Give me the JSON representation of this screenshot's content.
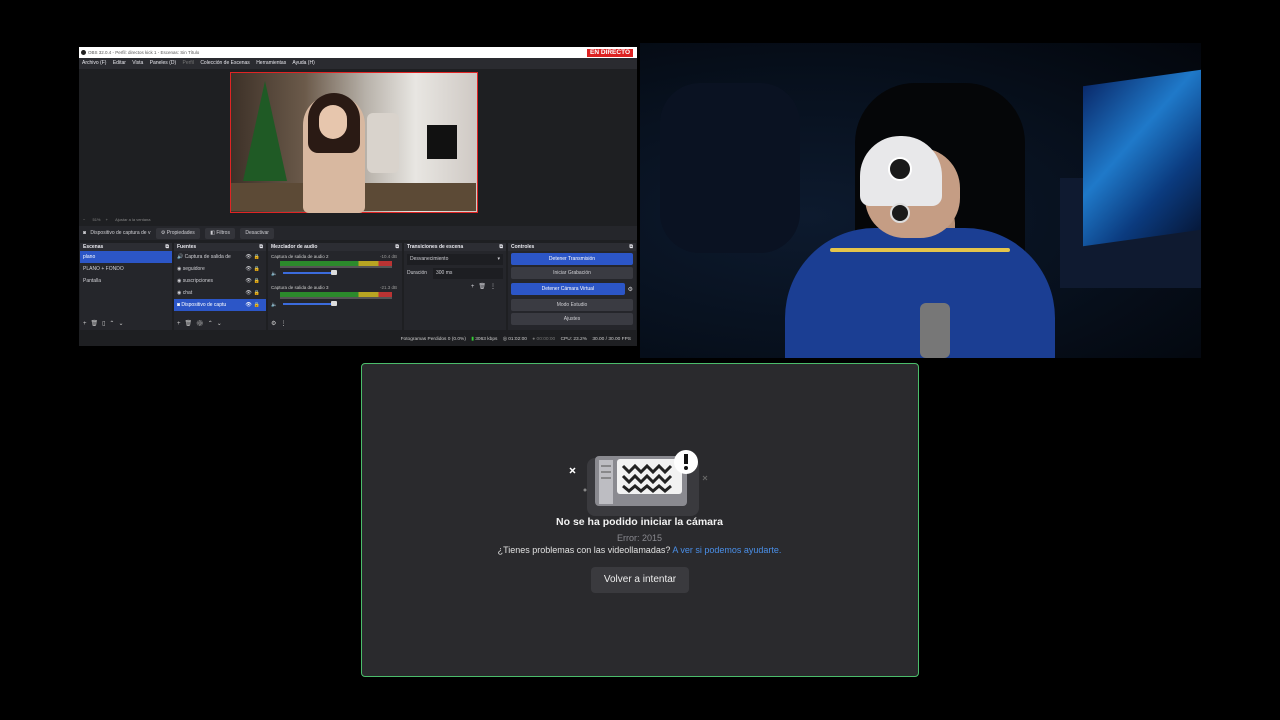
{
  "obs": {
    "title": "OBS 32.0.4 - Perfil: directos kick 1 - Escenas: Sin Título",
    "live_badge": "EN DIRECTO",
    "menu": [
      "Archivo (F)",
      "Editar",
      "Vista",
      "Paneles (D)",
      "Perfil",
      "Colección de Escenas",
      "Herramientas",
      "Ayuda (H)"
    ],
    "zoom": "51%",
    "fit_label": "Ajustar a la ventana",
    "source_bar": {
      "selected": "Dispositivo de captura de v",
      "properties": "Propiedades",
      "filters": "Filtros",
      "deactivate": "Desactivar"
    },
    "scenes": {
      "title": "Escenas",
      "items": [
        "plano",
        "PLANO + FONDO",
        "Pantalla"
      ]
    },
    "sources": {
      "title": "Fuentes",
      "items": [
        "Captura de salida de",
        "seguidore",
        "suscripciones",
        "chat",
        "Dispositivo de captu"
      ]
    },
    "mixer": {
      "title": "Mezclador de audio",
      "channels": [
        {
          "name": "Captura de salida de audio 2",
          "db": "-10.4 dB"
        },
        {
          "name": "Captura de salida de audio 3",
          "db": "-21.3 dB"
        }
      ]
    },
    "transitions": {
      "title": "Transiciones de escena",
      "selected": "Desvanecimiento",
      "duration_label": "Duración",
      "duration_value": "300 ms"
    },
    "controls": {
      "title": "Controles",
      "buttons": [
        "Detener Transmisión",
        "Iniciar Grabación",
        "Detener Cámara Virtual",
        "Modo Estudio",
        "Ajustes"
      ]
    },
    "status": {
      "dropped": "Fotogramas Perdidos 0 (0.0%)",
      "bitrate": "3063 kbps",
      "live_time": "01:02:00",
      "rec_time": "00:00:00",
      "cpu": "CPU: 23.2%",
      "fps": "30.00 / 30.00 FPS"
    }
  },
  "error": {
    "title": "No se ha podido iniciar la cámara",
    "code": "Error: 2015",
    "help_text": "¿Tienes problemas con las videollamadas?",
    "help_link": "A ver si podemos ayudarte.",
    "retry_label": "Volver a intentar"
  },
  "colors": {
    "panel_border": "#4bbd6b",
    "link": "#4a8fe8",
    "live": "#dd2222",
    "obs_accent": "#2c56c7"
  }
}
